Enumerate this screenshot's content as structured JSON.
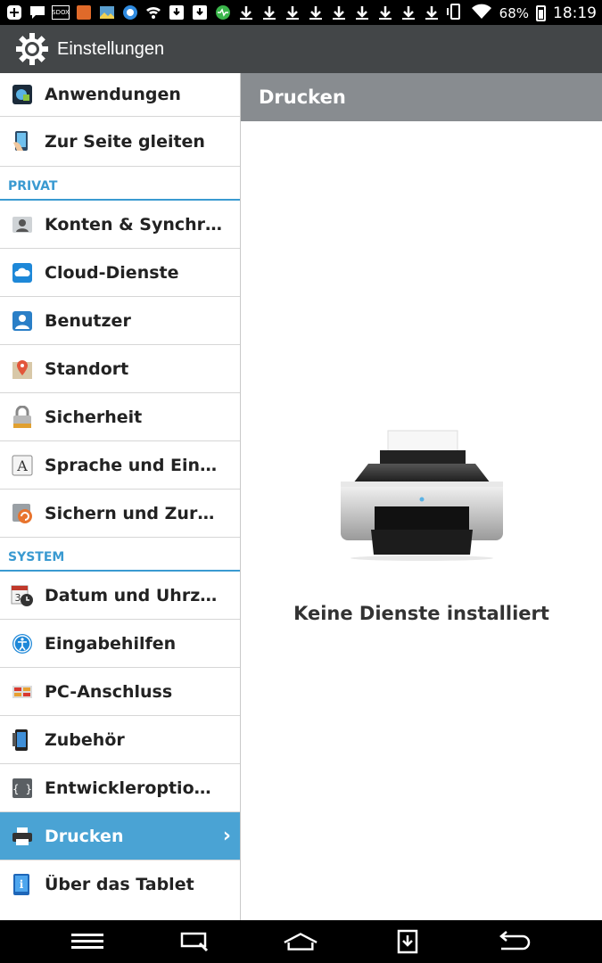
{
  "status_bar": {
    "battery": "68%",
    "time": "18:19",
    "left_icons": [
      "add-icon",
      "chat-icon",
      "sdox-icon",
      "app-icon",
      "photo-icon",
      "messenger-icon",
      "wifi-small-icon",
      "download-box-icon",
      "download-box-icon",
      "activity-icon",
      "download-icon",
      "download-icon",
      "download-icon",
      "download-icon",
      "download-icon",
      "download-icon",
      "download-icon",
      "download-icon",
      "download-icon"
    ],
    "sdox_label": "SDOX"
  },
  "app_bar": {
    "title": "Einstellungen"
  },
  "sidebar": {
    "items_top": [
      {
        "label": "Anwendungen",
        "icon": "apps-icon"
      },
      {
        "label": "Zur Seite gleiten",
        "icon": "swipe-icon"
      }
    ],
    "section_private": "PRIVAT",
    "items_private": [
      {
        "label": "Konten & Synchronisation",
        "icon": "accounts-icon"
      },
      {
        "label": "Cloud-Dienste",
        "icon": "cloud-icon"
      },
      {
        "label": "Benutzer",
        "icon": "user-icon"
      },
      {
        "label": "Standort",
        "icon": "location-icon"
      },
      {
        "label": "Sicherheit",
        "icon": "lock-icon"
      },
      {
        "label": "Sprache und Eingabe",
        "icon": "language-icon"
      },
      {
        "label": "Sichern und Zurücksetzen",
        "icon": "backup-icon"
      }
    ],
    "section_system": "SYSTEM",
    "items_system": [
      {
        "label": "Datum und Uhrzeit",
        "icon": "calendar-clock-icon"
      },
      {
        "label": "Eingabehilfen",
        "icon": "accessibility-icon"
      },
      {
        "label": "PC-Anschluss",
        "icon": "pc-connection-icon"
      },
      {
        "label": "Zubehör",
        "icon": "accessory-icon"
      },
      {
        "label": "Entwickleroptionen",
        "icon": "developer-icon"
      },
      {
        "label": "Drucken",
        "icon": "printer-icon",
        "active": true
      },
      {
        "label": "Über das Tablet",
        "icon": "info-icon"
      }
    ]
  },
  "detail": {
    "title": "Drucken",
    "empty_message": "Keine Dienste installiert"
  },
  "nav_bar": {
    "buttons": [
      "menu-icon",
      "quick-memo-icon",
      "home-icon",
      "notes-icon",
      "back-icon"
    ]
  },
  "colors": {
    "accent": "#3a9ad1",
    "active": "#4aa3d4",
    "appbar": "#434648",
    "detail_header": "#888c90"
  }
}
